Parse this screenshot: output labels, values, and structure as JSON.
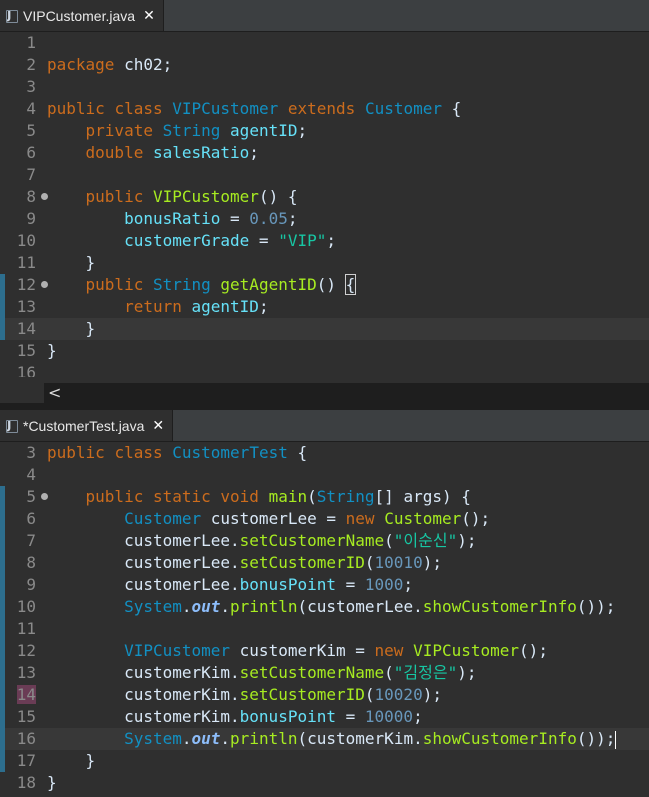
{
  "pane1": {
    "tab": {
      "title": "VIPCustomer.java",
      "close": "✕"
    },
    "lines": [
      {
        "n": "1",
        "tokens": []
      },
      {
        "n": "2",
        "tokens": [
          [
            "kw",
            "package"
          ],
          [
            "pln",
            " ch02;"
          ]
        ]
      },
      {
        "n": "3",
        "tokens": []
      },
      {
        "n": "4",
        "tokens": [
          [
            "kw",
            "public"
          ],
          [
            "pln",
            " "
          ],
          [
            "kw",
            "class"
          ],
          [
            "pln",
            " "
          ],
          [
            "typ",
            "VIPCustomer"
          ],
          [
            "pln",
            " "
          ],
          [
            "kw",
            "extends"
          ],
          [
            "pln",
            " "
          ],
          [
            "typ",
            "Customer"
          ],
          [
            "pln",
            " {"
          ]
        ]
      },
      {
        "n": "5",
        "tokens": [
          [
            "pln",
            "    "
          ],
          [
            "kw",
            "private"
          ],
          [
            "pln",
            " "
          ],
          [
            "typ",
            "String"
          ],
          [
            "pln",
            " "
          ],
          [
            "fld",
            "agentID"
          ],
          [
            "pln",
            ";"
          ]
        ]
      },
      {
        "n": "6",
        "tokens": [
          [
            "pln",
            "    "
          ],
          [
            "kw",
            "double"
          ],
          [
            "pln",
            " "
          ],
          [
            "fld",
            "salesRatio"
          ],
          [
            "pln",
            ";"
          ]
        ]
      },
      {
        "n": "7",
        "tokens": []
      },
      {
        "n": "8",
        "fold": true,
        "tokens": [
          [
            "pln",
            "    "
          ],
          [
            "kw",
            "public"
          ],
          [
            "pln",
            " "
          ],
          [
            "mth",
            "VIPCustomer"
          ],
          [
            "pln",
            "() {"
          ]
        ]
      },
      {
        "n": "9",
        "tokens": [
          [
            "pln",
            "        "
          ],
          [
            "fld",
            "bonusRatio"
          ],
          [
            "pln",
            " = "
          ],
          [
            "num",
            "0.05"
          ],
          [
            "pln",
            ";"
          ]
        ]
      },
      {
        "n": "10",
        "tokens": [
          [
            "pln",
            "        "
          ],
          [
            "fld",
            "customerGrade"
          ],
          [
            "pln",
            " = "
          ],
          [
            "str",
            "\"VIP\""
          ],
          [
            "pln",
            ";"
          ]
        ]
      },
      {
        "n": "11",
        "tokens": [
          [
            "pln",
            "    }"
          ]
        ]
      },
      {
        "n": "12",
        "fold": true,
        "change": true,
        "tokens": [
          [
            "pln",
            "    "
          ],
          [
            "kw",
            "public"
          ],
          [
            "pln",
            " "
          ],
          [
            "typ",
            "String"
          ],
          [
            "pln",
            " "
          ],
          [
            "mth",
            "getAgentID"
          ],
          [
            "pln",
            "() "
          ],
          [
            "brace",
            "{"
          ]
        ]
      },
      {
        "n": "13",
        "change": true,
        "tokens": [
          [
            "pln",
            "        "
          ],
          [
            "kw",
            "return"
          ],
          [
            "pln",
            " "
          ],
          [
            "fld",
            "agentID"
          ],
          [
            "pln",
            ";"
          ]
        ]
      },
      {
        "n": "14",
        "change": true,
        "current": true,
        "tokens": [
          [
            "pln",
            "    }"
          ]
        ]
      },
      {
        "n": "15",
        "tokens": [
          [
            "pln",
            "}"
          ]
        ]
      },
      {
        "n": "16",
        "tokens": []
      }
    ],
    "scroll_left": "<"
  },
  "pane2": {
    "tab": {
      "title": "*CustomerTest.java",
      "close": "✕"
    },
    "lines": [
      {
        "n": "3",
        "tokens": [
          [
            "kw",
            "public"
          ],
          [
            "pln",
            " "
          ],
          [
            "kw",
            "class"
          ],
          [
            "pln",
            " "
          ],
          [
            "typ",
            "CustomerTest"
          ],
          [
            "pln",
            " {"
          ]
        ]
      },
      {
        "n": "4",
        "tokens": []
      },
      {
        "n": "5",
        "fold": true,
        "change": true,
        "tokens": [
          [
            "pln",
            "    "
          ],
          [
            "kw",
            "public"
          ],
          [
            "pln",
            " "
          ],
          [
            "kw",
            "static"
          ],
          [
            "pln",
            " "
          ],
          [
            "kw",
            "void"
          ],
          [
            "pln",
            " "
          ],
          [
            "mth",
            "main"
          ],
          [
            "pln",
            "("
          ],
          [
            "typ",
            "String"
          ],
          [
            "pln",
            "[] "
          ],
          [
            "pln",
            "args) {"
          ]
        ]
      },
      {
        "n": "6",
        "change": true,
        "tokens": [
          [
            "pln",
            "        "
          ],
          [
            "typ",
            "Customer"
          ],
          [
            "pln",
            " "
          ],
          [
            "pln",
            "customerLee"
          ],
          [
            "pln",
            " = "
          ],
          [
            "kw",
            "new"
          ],
          [
            "pln",
            " "
          ],
          [
            "mth",
            "Customer"
          ],
          [
            "pln",
            "();"
          ]
        ]
      },
      {
        "n": "7",
        "change": true,
        "tokens": [
          [
            "pln",
            "        customerLee."
          ],
          [
            "mth",
            "setCustomerName"
          ],
          [
            "pln",
            "("
          ],
          [
            "str",
            "\"이순신\""
          ],
          [
            "pln",
            ");"
          ]
        ]
      },
      {
        "n": "8",
        "change": true,
        "tokens": [
          [
            "pln",
            "        customerLee."
          ],
          [
            "mth",
            "setCustomerID"
          ],
          [
            "pln",
            "("
          ],
          [
            "num",
            "10010"
          ],
          [
            "pln",
            ");"
          ]
        ]
      },
      {
        "n": "9",
        "change": true,
        "tokens": [
          [
            "pln",
            "        customerLee."
          ],
          [
            "fld",
            "bonusPoint"
          ],
          [
            "pln",
            " = "
          ],
          [
            "num",
            "1000"
          ],
          [
            "pln",
            ";"
          ]
        ]
      },
      {
        "n": "10",
        "change": true,
        "tokens": [
          [
            "pln",
            "        "
          ],
          [
            "typ",
            "System"
          ],
          [
            "pln",
            "."
          ],
          [
            "stat",
            "out"
          ],
          [
            "pln",
            "."
          ],
          [
            "mth",
            "println"
          ],
          [
            "pln",
            "(customerLee."
          ],
          [
            "mth",
            "showCustomerInfo"
          ],
          [
            "pln",
            "());"
          ]
        ]
      },
      {
        "n": "11",
        "change": true,
        "tokens": []
      },
      {
        "n": "12",
        "change": true,
        "tokens": [
          [
            "pln",
            "        "
          ],
          [
            "typ",
            "VIPCustomer"
          ],
          [
            "pln",
            " customerKim = "
          ],
          [
            "kw",
            "new"
          ],
          [
            "pln",
            " "
          ],
          [
            "mth",
            "VIPCustomer"
          ],
          [
            "pln",
            "();"
          ]
        ]
      },
      {
        "n": "13",
        "change": true,
        "tokens": [
          [
            "pln",
            "        customerKim."
          ],
          [
            "mth",
            "setCustomerName"
          ],
          [
            "pln",
            "("
          ],
          [
            "str",
            "\"김정은\""
          ],
          [
            "pln",
            ");"
          ]
        ]
      },
      {
        "n": "14",
        "change": true,
        "hl": true,
        "tokens": [
          [
            "pln",
            "        customerKim."
          ],
          [
            "mth",
            "setCustomerID"
          ],
          [
            "pln",
            "("
          ],
          [
            "num",
            "10020"
          ],
          [
            "pln",
            ");"
          ]
        ]
      },
      {
        "n": "15",
        "change": true,
        "tokens": [
          [
            "pln",
            "        customerKim."
          ],
          [
            "fld",
            "bonusPoint"
          ],
          [
            "pln",
            " = "
          ],
          [
            "num",
            "10000"
          ],
          [
            "pln",
            ";"
          ]
        ]
      },
      {
        "n": "16",
        "change": true,
        "current": true,
        "caret": true,
        "tokens": [
          [
            "pln",
            "        "
          ],
          [
            "typ",
            "System"
          ],
          [
            "pln",
            "."
          ],
          [
            "stat",
            "out"
          ],
          [
            "pln",
            "."
          ],
          [
            "mth",
            "println"
          ],
          [
            "pln",
            "(customerKim."
          ],
          [
            "mth",
            "showCustomerInfo"
          ],
          [
            "pln",
            "());"
          ]
        ]
      },
      {
        "n": "17",
        "change": true,
        "tokens": [
          [
            "pln",
            "    }"
          ]
        ]
      },
      {
        "n": "18",
        "tokens": [
          [
            "pln",
            "}"
          ]
        ]
      }
    ]
  }
}
